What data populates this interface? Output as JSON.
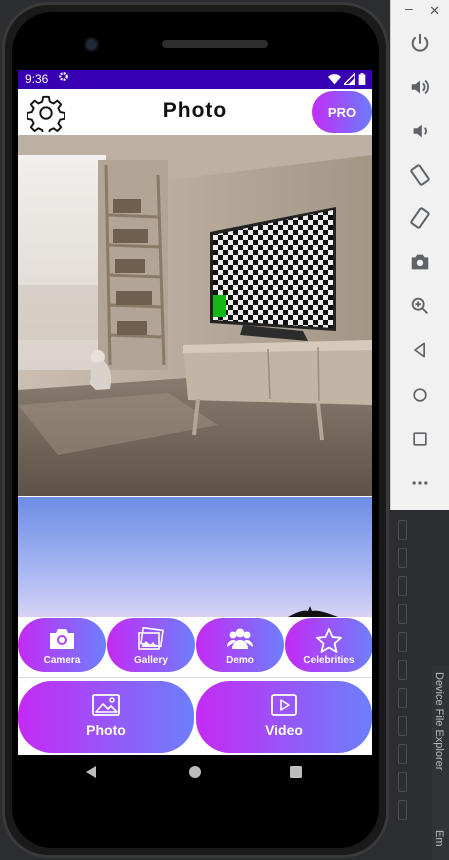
{
  "status_bar": {
    "time": "9:36"
  },
  "app": {
    "title": "Photo",
    "pro_label": "PRO"
  },
  "features": [
    {
      "label": "Camera",
      "icon": "camera-icon"
    },
    {
      "label": "Gallery",
      "icon": "gallery-icon"
    },
    {
      "label": "Demo",
      "icon": "group-icon"
    },
    {
      "label": "Celebrities",
      "icon": "star-icon"
    }
  ],
  "bottom_nav": [
    {
      "label": "Photo",
      "icon": "image-icon"
    },
    {
      "label": "Video",
      "icon": "play-icon"
    }
  ],
  "emulator_controls": [
    "power-icon",
    "volume-up-icon",
    "volume-down-icon",
    "rotate-left-icon",
    "rotate-right-icon",
    "screenshot-icon",
    "zoom-icon",
    "back-icon",
    "home-icon",
    "overview-icon",
    "more-icon"
  ],
  "ide": {
    "panel_label": "Device File Explorer",
    "panel_label2": "Em"
  },
  "colors": {
    "status_bar": "#3700b3",
    "gradient_start": "#c52af6",
    "gradient_end": "#6c80fb"
  }
}
